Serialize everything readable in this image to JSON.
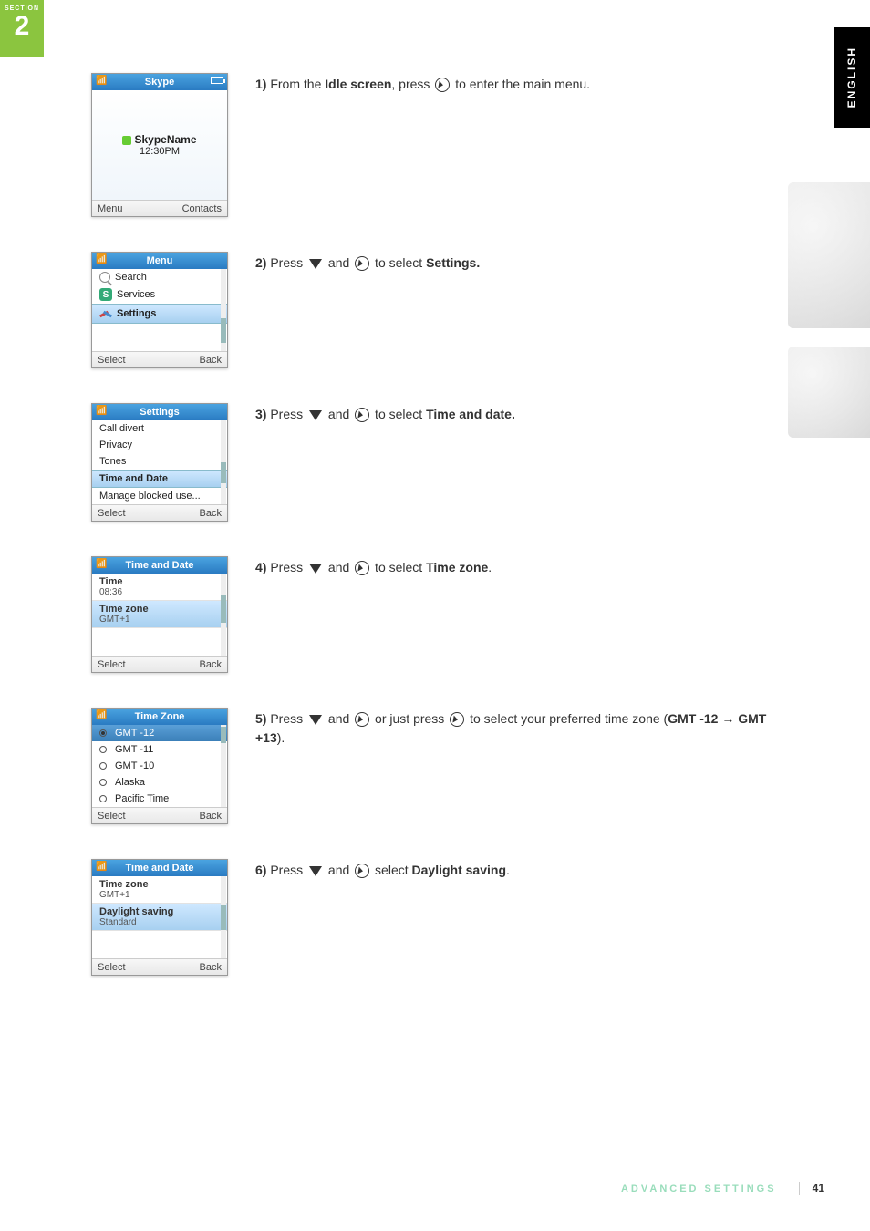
{
  "section": {
    "label": "SECTION",
    "number": "2"
  },
  "language_tab": "ENGLISH",
  "steps": [
    {
      "num": "1)",
      "parts": [
        {
          "t": "plain",
          "v": "From the "
        },
        {
          "t": "bold",
          "v": "Idle screen"
        },
        {
          "t": "plain",
          "v": ", press "
        },
        {
          "t": "sel"
        },
        {
          "t": "plain",
          "v": " to enter the main menu."
        }
      ]
    },
    {
      "num": "2)",
      "parts": [
        {
          "t": "plain",
          "v": "Press "
        },
        {
          "t": "down"
        },
        {
          "t": "plain",
          "v": " and "
        },
        {
          "t": "sel"
        },
        {
          "t": "plain",
          "v": " to select "
        },
        {
          "t": "bold",
          "v": "Settings."
        }
      ]
    },
    {
      "num": "3)",
      "parts": [
        {
          "t": "plain",
          "v": "Press "
        },
        {
          "t": "down"
        },
        {
          "t": "plain",
          "v": " and "
        },
        {
          "t": "sel"
        },
        {
          "t": "plain",
          "v": " to select "
        },
        {
          "t": "bold",
          "v": "Time and date."
        }
      ]
    },
    {
      "num": "4)",
      "parts": [
        {
          "t": "plain",
          "v": "Press "
        },
        {
          "t": "down"
        },
        {
          "t": "plain",
          "v": " and "
        },
        {
          "t": "sel"
        },
        {
          "t": "plain",
          "v": " to select "
        },
        {
          "t": "bold",
          "v": "Time zone"
        },
        {
          "t": "plain",
          "v": "."
        }
      ]
    },
    {
      "num": "5)",
      "parts": [
        {
          "t": "plain",
          "v": "Press "
        },
        {
          "t": "down"
        },
        {
          "t": "plain",
          "v": " and "
        },
        {
          "t": "sel"
        },
        {
          "t": "plain",
          "v": " or just press "
        },
        {
          "t": "sel"
        },
        {
          "t": "plain",
          "v": " to select your preferred time zone ("
        },
        {
          "t": "bold",
          "v": "GMT -12 → GMT +13"
        },
        {
          "t": "plain",
          "v": ")."
        }
      ]
    },
    {
      "num": "6)",
      "parts": [
        {
          "t": "plain",
          "v": "Press "
        },
        {
          "t": "down"
        },
        {
          "t": "plain",
          "v": " and "
        },
        {
          "t": "sel"
        },
        {
          "t": "plain",
          "v": " select "
        },
        {
          "t": "bold",
          "v": "Daylight saving"
        },
        {
          "t": "plain",
          "v": "."
        }
      ]
    }
  ],
  "screens": {
    "idle": {
      "title": "Skype",
      "name": "SkypeName",
      "time": "12:30PM",
      "sk_left": "Menu",
      "sk_right": "Contacts"
    },
    "menu": {
      "title": "Menu",
      "items": [
        "Search",
        "Services",
        "Settings"
      ],
      "sk_left": "Select",
      "sk_right": "Back"
    },
    "settings": {
      "title": "Settings",
      "items": [
        "Call divert",
        "Privacy",
        "Tones",
        "Time and Date",
        "Manage blocked use..."
      ],
      "hl_index": 3,
      "sk_left": "Select",
      "sk_right": "Back"
    },
    "timedate1": {
      "title": "Time and Date",
      "g1_label": "Time",
      "g1_val": "08:36",
      "g2_label": "Time zone",
      "g2_val": "GMT+1",
      "sk_left": "Select",
      "sk_right": "Back"
    },
    "timezone": {
      "title": "Time Zone",
      "items": [
        "GMT -12",
        "GMT -11",
        "GMT -10",
        "Alaska",
        "Pacific Time"
      ],
      "hl_index": 0,
      "sk_left": "Select",
      "sk_right": "Back"
    },
    "timedate2": {
      "title": "Time and Date",
      "g1_label": "Time zone",
      "g1_val": "GMT+1",
      "g2_label": "Daylight saving",
      "g2_val": "Standard",
      "sk_left": "Select",
      "sk_right": "Back"
    }
  },
  "footer": {
    "label": "ADVANCED SETTINGS",
    "page": "41"
  }
}
